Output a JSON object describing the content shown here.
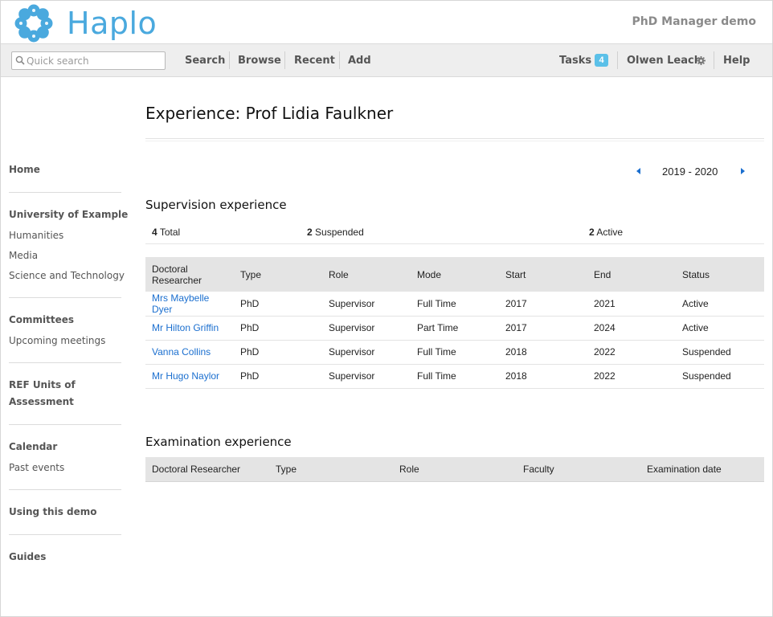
{
  "header": {
    "logo_text": "Haplo",
    "app_name": "PhD Manager demo"
  },
  "toolbar": {
    "search_placeholder": "Quick search",
    "nav": [
      "Search",
      "Browse",
      "Recent",
      "Add"
    ],
    "tasks_label": "Tasks",
    "tasks_count": "4",
    "user_name": "Olwen Leach",
    "help_label": "Help"
  },
  "sidebar": {
    "home": "Home",
    "university": "University of Example",
    "university_items": [
      "Humanities",
      "Media",
      "Science and Technology"
    ],
    "committees": "Committees",
    "committee_items": [
      "Upcoming meetings"
    ],
    "ref_units": "REF Units of Assessment",
    "calendar": "Calendar",
    "calendar_items": [
      "Past events"
    ],
    "using_demo": "Using this demo",
    "guides": "Guides"
  },
  "main": {
    "title": "Experience: Prof Lidia Faulkner",
    "year_range": "2019 - 2020",
    "supervision": {
      "heading": "Supervision experience",
      "summary": {
        "total_count": "4",
        "total_label": "Total",
        "suspended_count": "2",
        "suspended_label": "Suspended",
        "active_count": "2",
        "active_label": "Active"
      },
      "columns": [
        "Doctoral Researcher",
        "Type",
        "Role",
        "Mode",
        "Start",
        "End",
        "Status"
      ],
      "rows": [
        {
          "name": "Mrs Maybelle Dyer",
          "type": "PhD",
          "role": "Supervisor",
          "mode": "Full Time",
          "start": "2017",
          "end": "2021",
          "status": "Active"
        },
        {
          "name": "Mr Hilton Griffin",
          "type": "PhD",
          "role": "Supervisor",
          "mode": "Part Time",
          "start": "2017",
          "end": "2024",
          "status": "Active"
        },
        {
          "name": "Vanna Collins",
          "type": "PhD",
          "role": "Supervisor",
          "mode": "Full Time",
          "start": "2018",
          "end": "2022",
          "status": "Suspended"
        },
        {
          "name": "Mr Hugo Naylor",
          "type": "PhD",
          "role": "Supervisor",
          "mode": "Full Time",
          "start": "2018",
          "end": "2022",
          "status": "Suspended"
        }
      ]
    },
    "examination": {
      "heading": "Examination experience",
      "columns": [
        "Doctoral Researcher",
        "Type",
        "Role",
        "Faculty",
        "Examination date"
      ]
    }
  },
  "colors": {
    "brand": "#4aa9de",
    "link": "#1b6fcf",
    "badge": "#5bc0e8"
  }
}
